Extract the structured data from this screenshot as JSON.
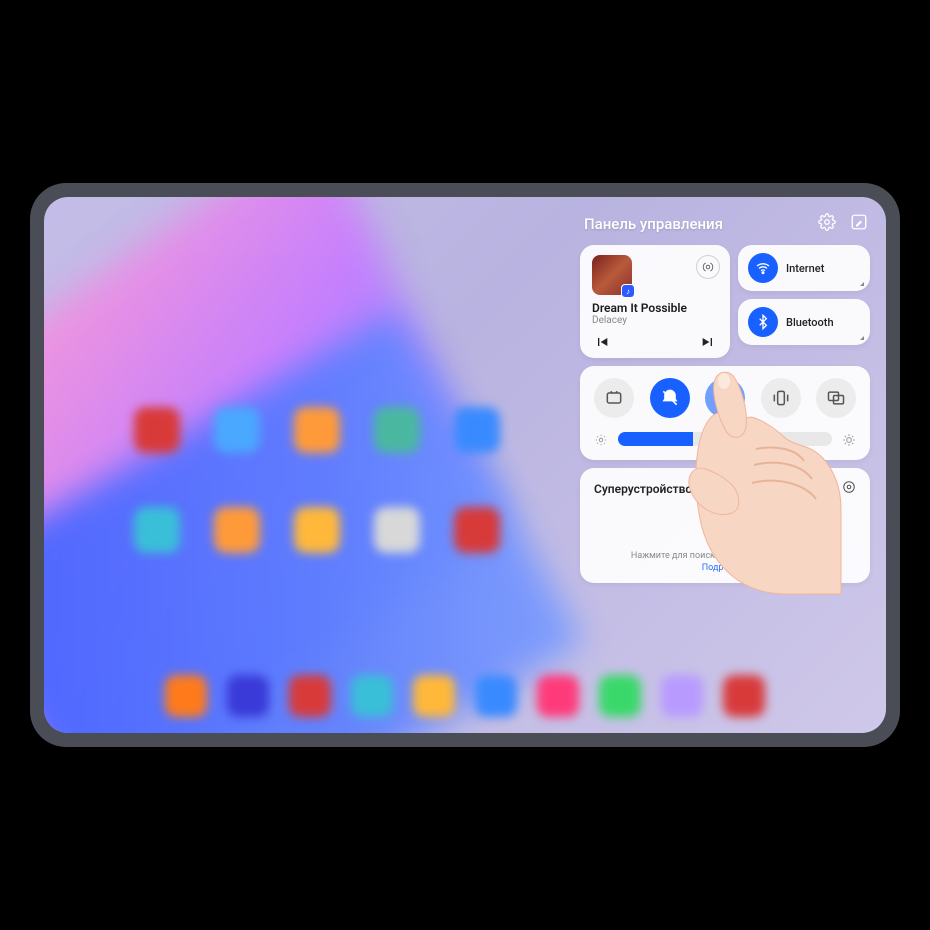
{
  "panel": {
    "title": "Панель управления"
  },
  "media": {
    "track_title": "Dream It Possible",
    "track_artist": "Delacey"
  },
  "connectivity": {
    "wifi_label": "Internet",
    "bluetooth_label": "Bluetooth"
  },
  "toggles": {
    "screenshot": false,
    "mute": true,
    "unknown_active": true,
    "vibrate": false,
    "multiwindow": false
  },
  "brightness": {
    "percent": 35
  },
  "superdevice": {
    "title": "Суперустройство",
    "hint": "Нажмите для поиска устройств поблизости.",
    "more_label": "Подробнее"
  },
  "home_apps": {
    "row1_colors": [
      "#d83a3a",
      "#4aa8ff",
      "#ff9a3a",
      "#4ab8a0",
      "#3a8aff"
    ],
    "row2_colors": [
      "#3abfd8",
      "#ff9a3a",
      "#ffb83a",
      "#d8d8d8",
      "#d83a3a"
    ],
    "dock_colors": [
      "#ff7a1a",
      "#3a3ad8",
      "#d83a3a",
      "#3abfd8",
      "#ffb83a",
      "#3a8aff",
      "#ff3a7a",
      "#3ad86a",
      "#b89aff",
      "#d83a3a"
    ]
  }
}
